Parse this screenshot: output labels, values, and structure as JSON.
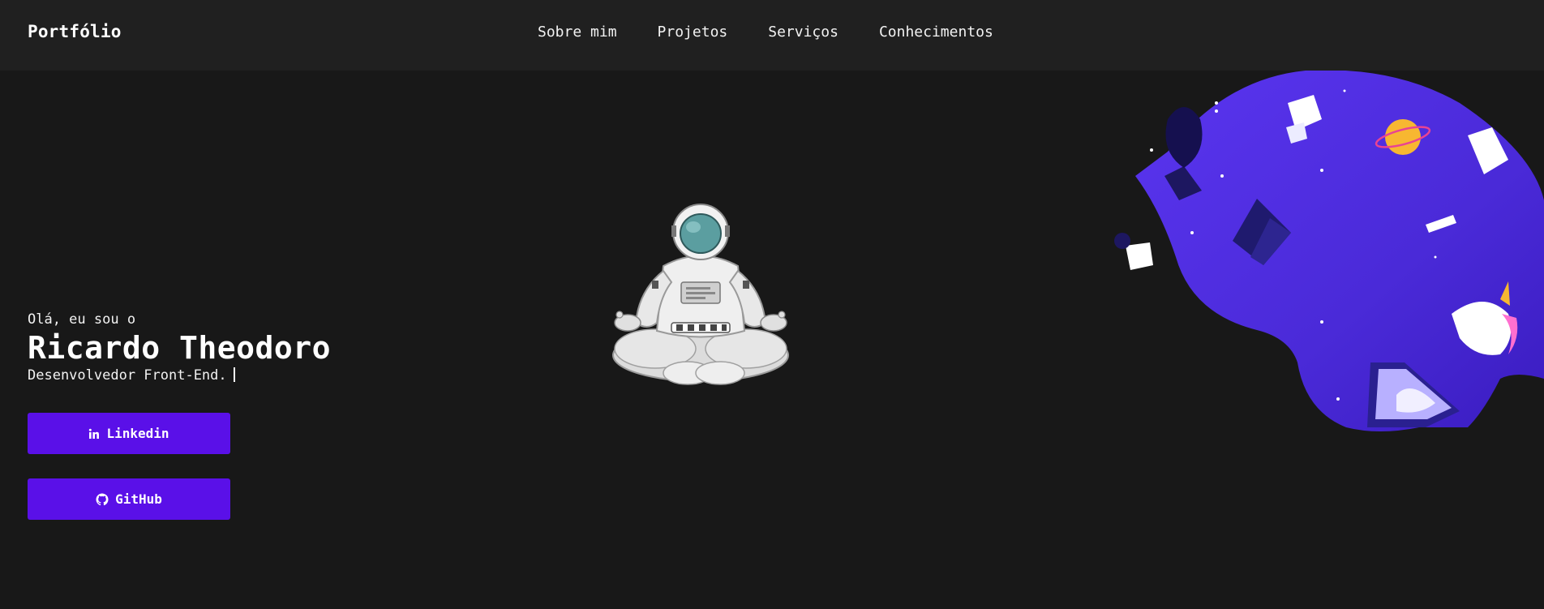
{
  "nav": {
    "brand": "Portfólio",
    "links": [
      {
        "label": "Sobre mim"
      },
      {
        "label": "Projetos"
      },
      {
        "label": "Serviços"
      },
      {
        "label": "Conhecimentos"
      }
    ]
  },
  "hero": {
    "greeting": "Olá, eu sou o",
    "name": "Ricardo Theodoro",
    "role": "Desenvolvedor Front-End."
  },
  "buttons": {
    "linkedin": {
      "label": "Linkedin",
      "icon": "linkedin-icon"
    },
    "github": {
      "label": "GitHub",
      "icon": "github-icon"
    }
  },
  "colors": {
    "background": "#181818",
    "navbar": "#202020",
    "accent": "#5a10e8",
    "blob": "#4b2ee0"
  }
}
